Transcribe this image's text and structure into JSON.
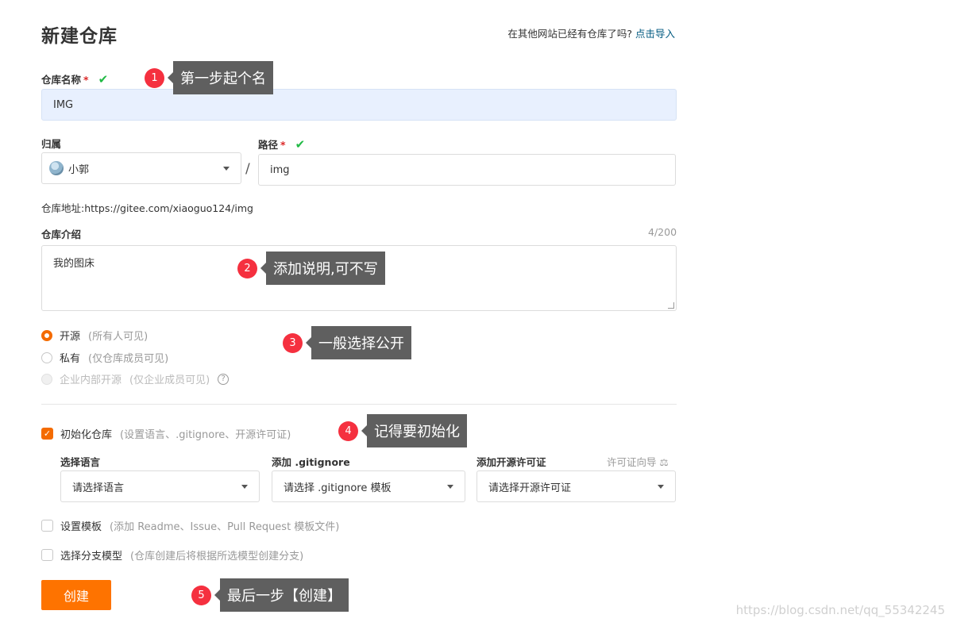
{
  "header": {
    "title": "新建仓库",
    "import_question": "在其他网站已经有仓库了吗?",
    "import_link": "点击导入"
  },
  "repo_name": {
    "label": "仓库名称",
    "required_mark": "*",
    "valid_mark": "✔",
    "value": "IMG"
  },
  "owner": {
    "label": "归属",
    "value": "小郭"
  },
  "path_separator": "/",
  "path": {
    "label": "路径",
    "required_mark": "*",
    "valid_mark": "✔",
    "value": "img"
  },
  "repo_url": "仓库地址:https://gitee.com/xiaoguo124/img",
  "description": {
    "label": "仓库介绍",
    "counter": "4/200",
    "value": "我的图床"
  },
  "visibility": {
    "options": [
      {
        "label": "开源",
        "hint": "(所有人可见)",
        "selected": true,
        "disabled": false
      },
      {
        "label": "私有",
        "hint": "(仅仓库成员可见)",
        "selected": false,
        "disabled": false
      },
      {
        "label": "企业内部开源",
        "hint": "(仅企业成员可见)",
        "selected": false,
        "disabled": true
      }
    ],
    "help_icon": "?"
  },
  "init": {
    "checked": true,
    "check_mark": "✓",
    "label": "初始化仓库",
    "hint": "(设置语言、.gitignore、开源许可证)",
    "language": {
      "label": "选择语言",
      "placeholder": "请选择语言"
    },
    "gitignore": {
      "label": "添加 .gitignore",
      "placeholder": "请选择 .gitignore 模板"
    },
    "license": {
      "label": "添加开源许可证",
      "guide": "许可证向导",
      "guide_icon": "⚖",
      "placeholder": "请选择开源许可证"
    }
  },
  "template": {
    "checked": false,
    "label": "设置模板",
    "hint": "(添加 Readme、Issue、Pull Request 模板文件)"
  },
  "branch_model": {
    "checked": false,
    "label": "选择分支模型",
    "hint": "(仓库创建后将根据所选模型创建分支)"
  },
  "create_button": "创建",
  "annotations": [
    {
      "num": "1",
      "text": "第一步起个名"
    },
    {
      "num": "2",
      "text": "添加说明,可不写"
    },
    {
      "num": "3",
      "text": "一般选择公开"
    },
    {
      "num": "4",
      "text": "记得要初始化"
    },
    {
      "num": "5",
      "text": "最后一步【创建】"
    }
  ],
  "watermark": "https://blog.csdn.net/qq_55342245",
  "colors": {
    "accent": "#fe7300",
    "link": "#005980",
    "valid": "#21ba45",
    "required": "#db2828",
    "annotation_badge": "#f5303f",
    "annotation_tip": "#5f5f5f"
  }
}
